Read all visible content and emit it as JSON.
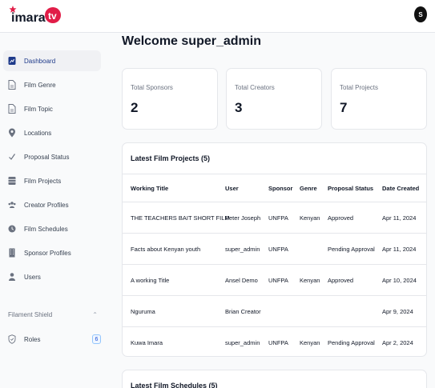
{
  "brand": {
    "logo_text": "imara.tv",
    "accent": "#e11d48"
  },
  "user": {
    "initial": "S"
  },
  "sidebar": {
    "items": [
      {
        "label": "Dashboard",
        "icon": "dashboard-icon",
        "active": true
      },
      {
        "label": "Film Genre",
        "icon": "document-icon"
      },
      {
        "label": "Film Topic",
        "icon": "document-icon"
      },
      {
        "label": "Locations",
        "icon": "map-pin-icon"
      },
      {
        "label": "Proposal Status",
        "icon": "check-icon"
      },
      {
        "label": "Film Projects",
        "icon": "table-icon"
      },
      {
        "label": "Creator Profiles",
        "icon": "users-icon"
      },
      {
        "label": "Film Schedules",
        "icon": "clock-icon"
      },
      {
        "label": "Sponsor Profiles",
        "icon": "building-icon"
      },
      {
        "label": "Users",
        "icon": "user-icon"
      }
    ],
    "group": {
      "label": "Filament Shield",
      "chevron": "⌃"
    },
    "roles": {
      "label": "Roles",
      "icon": "shield-icon",
      "badge": "6"
    }
  },
  "main": {
    "title": "Welcome super_admin",
    "stats": [
      {
        "label": "Total Sponsors",
        "value": "2"
      },
      {
        "label": "Total Creators",
        "value": "3"
      },
      {
        "label": "Total Projects",
        "value": "7"
      }
    ],
    "projects_table": {
      "title": "Latest Film Projects (5)",
      "columns": [
        "Working Title",
        "User",
        "Sponsor",
        "Genre",
        "Proposal Status",
        "Date Created"
      ],
      "rows": [
        [
          "THE TEACHERS BAIT SHORT FILM",
          "Peter Joseph",
          "UNFPA",
          "Kenyan",
          "Approved",
          "Apr 11, 2024"
        ],
        [
          "Facts about Kenyan youth",
          "super_admin",
          "UNFPA",
          "",
          "Pending Approval",
          "Apr 11, 2024"
        ],
        [
          "A working Title",
          "Ansel Demo",
          "UNFPA",
          "Kenyan",
          "Approved",
          "Apr 10, 2024"
        ],
        [
          "Nguruma",
          "Brian Creator",
          "",
          "",
          "",
          "Apr 9, 2024"
        ],
        [
          "Kuwa Imara",
          "super_admin",
          "UNFPA",
          "Kenyan",
          "Pending Approval",
          "Apr 2, 2024"
        ]
      ]
    },
    "schedules_title": "Latest Film Schedules (5)"
  }
}
